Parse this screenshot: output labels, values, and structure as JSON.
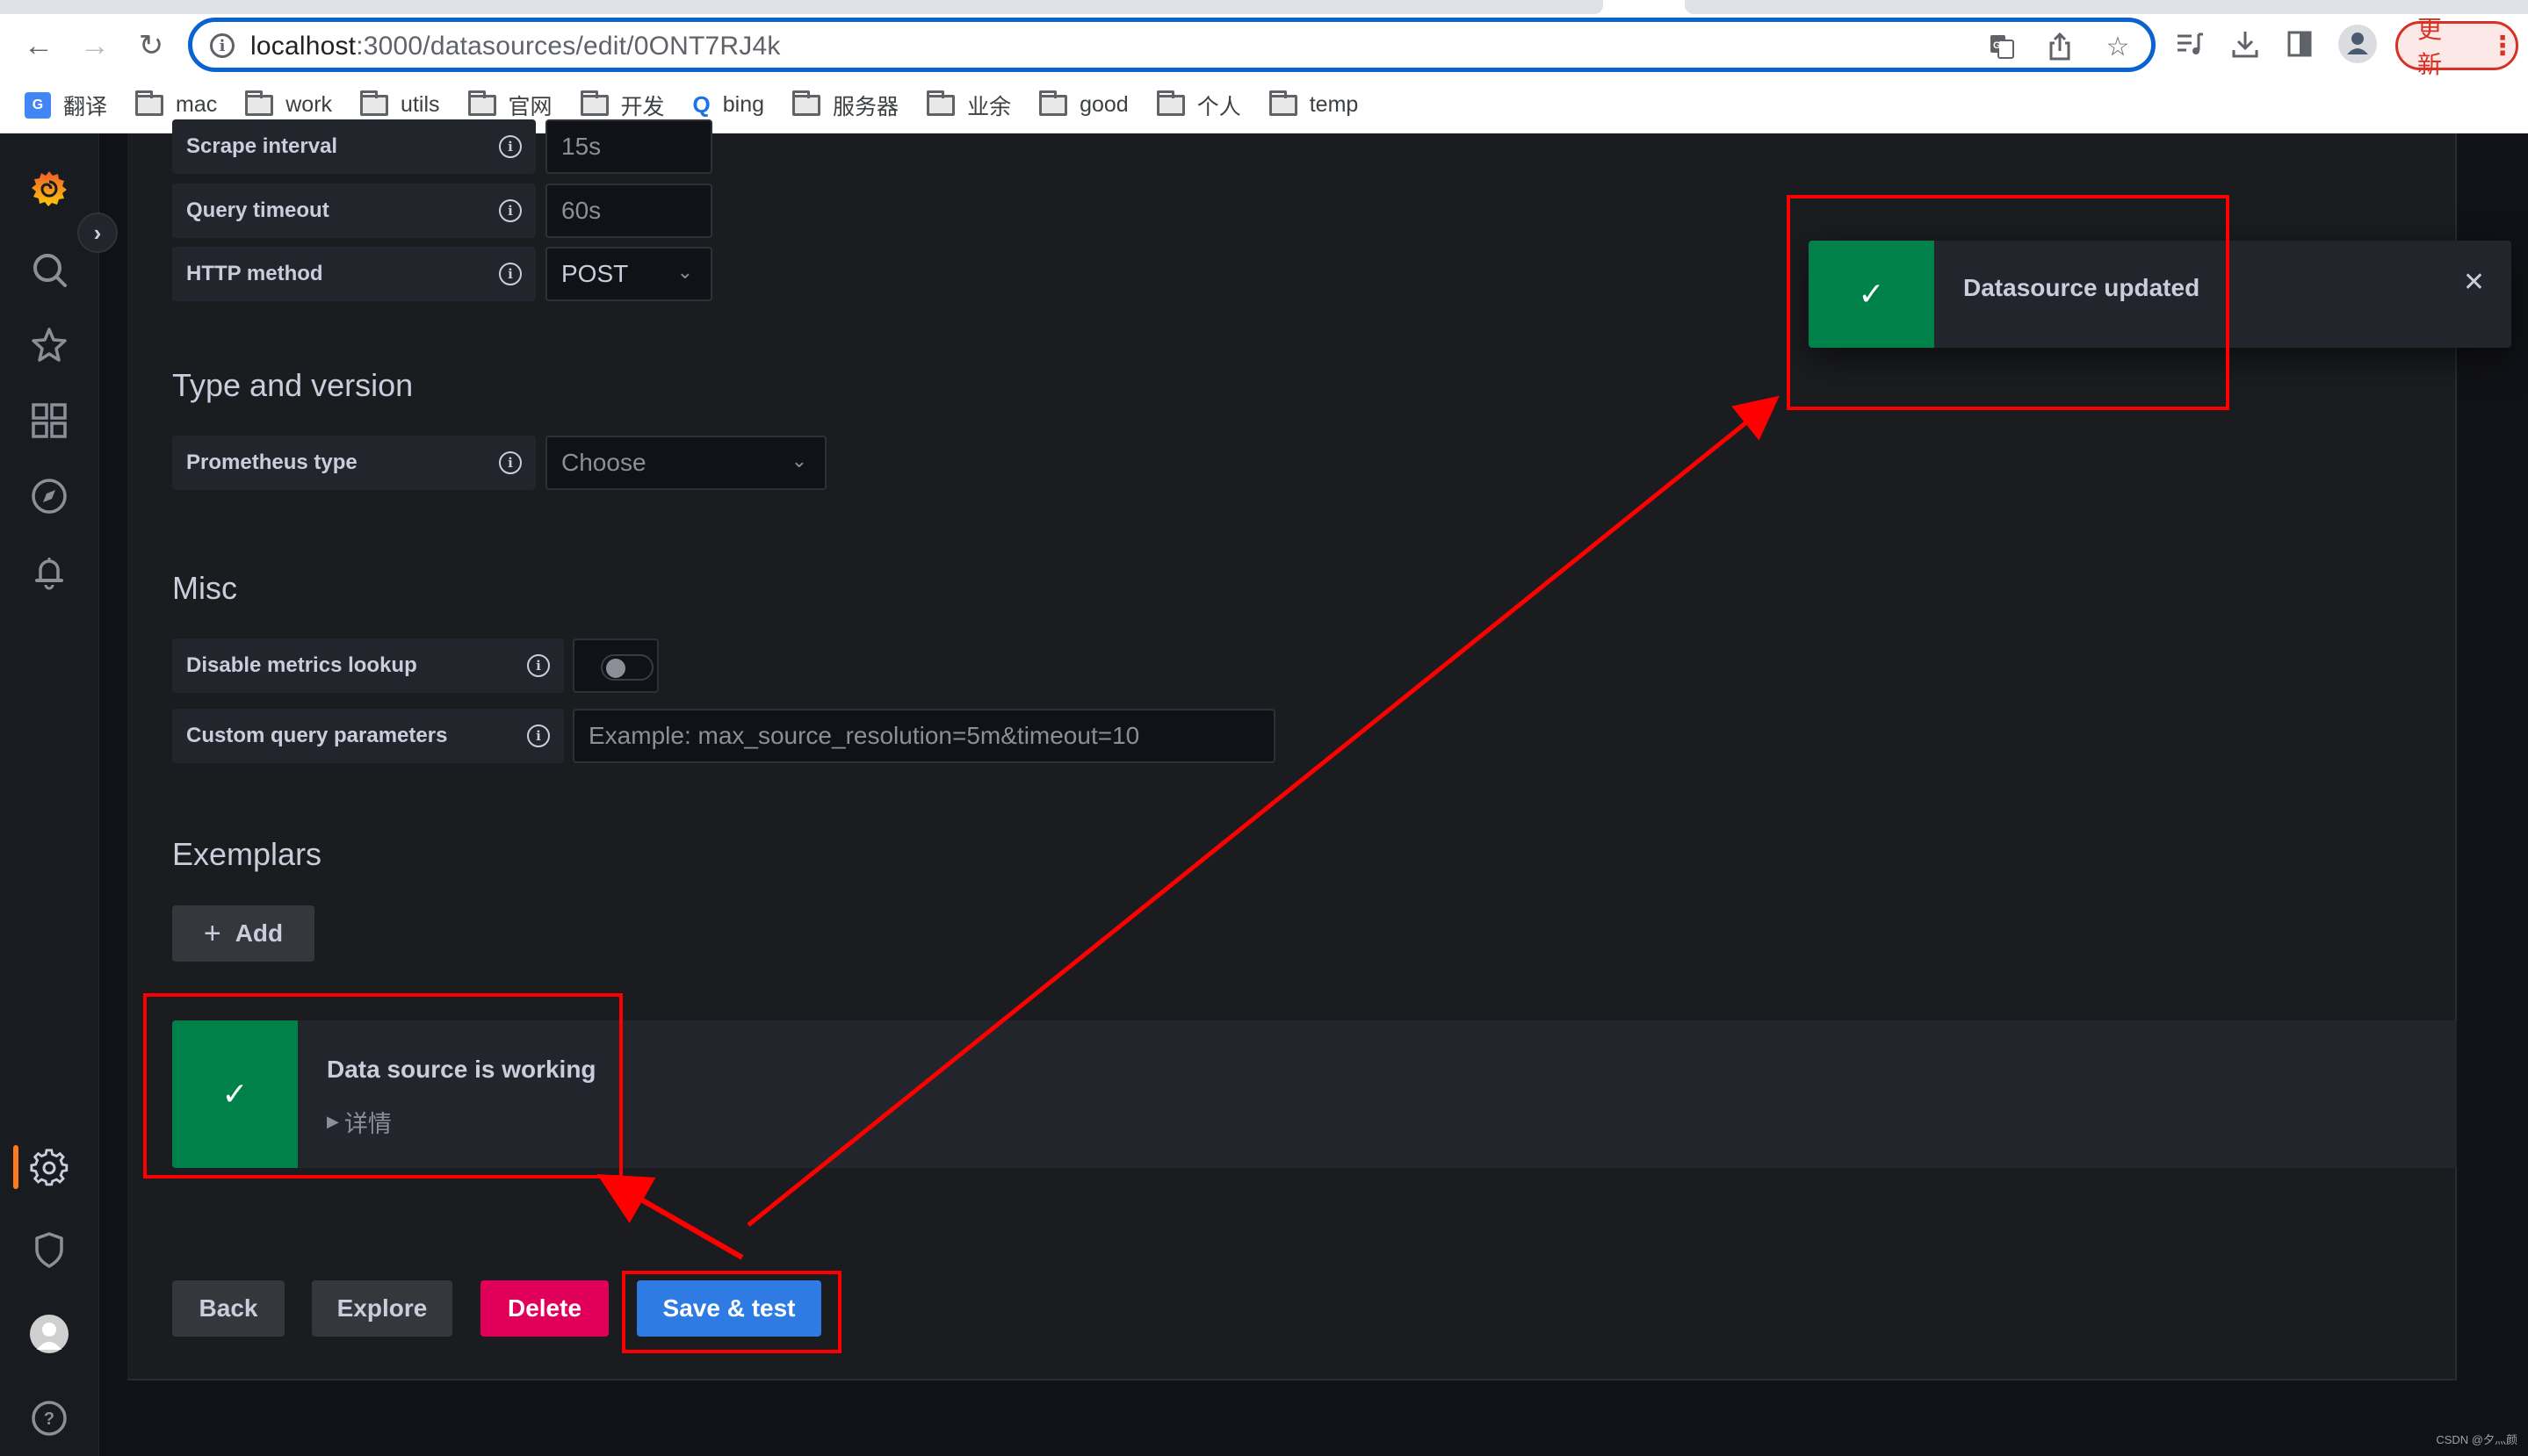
{
  "browser": {
    "url_host": "localhost",
    "url_path": ":3000/datasources/edit/0ONT7RJ4k",
    "update_button_label": "更新",
    "bookmarks": [
      {
        "label": "翻译",
        "icon": "google-translate-icon"
      },
      {
        "label": "mac",
        "icon": "folder-icon"
      },
      {
        "label": "work",
        "icon": "folder-icon"
      },
      {
        "label": "utils",
        "icon": "folder-icon"
      },
      {
        "label": "官网",
        "icon": "folder-icon"
      },
      {
        "label": "开发",
        "icon": "folder-icon"
      },
      {
        "label": "bing",
        "icon": "search-icon"
      },
      {
        "label": "服务器",
        "icon": "folder-icon"
      },
      {
        "label": "业余",
        "icon": "folder-icon"
      },
      {
        "label": "good",
        "icon": "folder-icon"
      },
      {
        "label": "个人",
        "icon": "folder-icon"
      },
      {
        "label": "temp",
        "icon": "folder-icon"
      }
    ]
  },
  "sidebar": {
    "items": [
      {
        "name": "grafana-logo-icon"
      },
      {
        "name": "search-icon"
      },
      {
        "name": "star-icon"
      },
      {
        "name": "dashboards-icon"
      },
      {
        "name": "explore-compass-icon"
      },
      {
        "name": "alerting-bell-icon"
      },
      {
        "name": "configuration-gear-icon",
        "active": true
      },
      {
        "name": "server-admin-shield-icon"
      },
      {
        "name": "user-avatar-icon"
      },
      {
        "name": "help-icon"
      }
    ],
    "accent_color": "#ff7a1a"
  },
  "form": {
    "scrape_interval": {
      "label": "Scrape interval",
      "placeholder": "15s"
    },
    "query_timeout": {
      "label": "Query timeout",
      "placeholder": "60s"
    },
    "http_method": {
      "label": "HTTP method",
      "value": "POST"
    },
    "type_version": {
      "title": "Type and version",
      "prometheus_type": {
        "label": "Prometheus type",
        "placeholder": "Choose"
      }
    },
    "misc": {
      "title": "Misc",
      "disable_metrics_lookup": {
        "label": "Disable metrics lookup",
        "enabled": false
      },
      "custom_query_parameters": {
        "label": "Custom query parameters",
        "placeholder": "Example: max_source_resolution=5m&timeout=10"
      }
    },
    "exemplars": {
      "title": "Exemplars",
      "add_label": "Add"
    }
  },
  "alert": {
    "title": "Data source is working",
    "details_label": "详情",
    "status_color": "#00814a"
  },
  "actions": {
    "back": "Back",
    "explore": "Explore",
    "delete": "Delete",
    "save_test": "Save & test"
  },
  "toast": {
    "message": "Datasource updated",
    "status_color": "#00814a"
  },
  "watermark": "CSDN @夕灬颜"
}
